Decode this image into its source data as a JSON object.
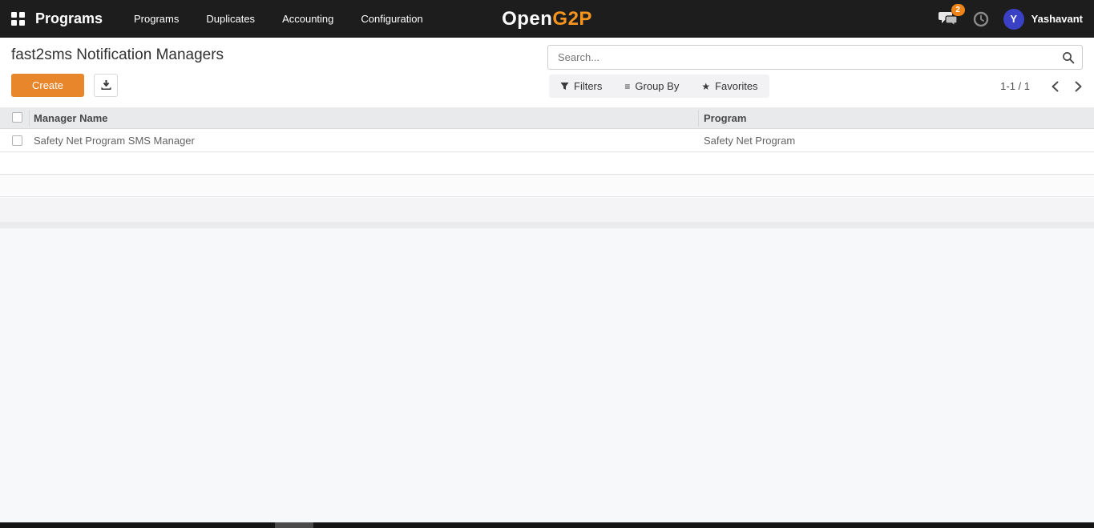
{
  "navbar": {
    "app_name": "Programs",
    "menu_items": [
      "Programs",
      "Duplicates",
      "Accounting",
      "Configuration"
    ],
    "logo": {
      "part1": "Open",
      "part2": "G2P"
    },
    "chat_badge": "2",
    "user": {
      "initial": "Y",
      "name": "Yashavant"
    }
  },
  "control_panel": {
    "title": "fast2sms Notification Managers",
    "create_label": "Create",
    "search": {
      "placeholder": "Search...",
      "value": ""
    },
    "filters_label": "Filters",
    "group_by_label": "Group By",
    "favorites_label": "Favorites",
    "pager_range": "1-1 / 1"
  },
  "table": {
    "columns": [
      "Manager Name",
      "Program"
    ],
    "rows": [
      {
        "manager_name": "Safety Net Program SMS Manager",
        "program": "Safety Net Program"
      }
    ]
  },
  "icons": {
    "group_by_glyph": "≡",
    "favorites_glyph": "★"
  },
  "colors": {
    "navbar_bg": "#1d1d1d",
    "brand_orange": "#f7941e",
    "primary_button": "#e8862b",
    "badge_orange": "#ee8418",
    "avatar_blue": "#3b41c5",
    "header_bg": "#e9eaec"
  }
}
